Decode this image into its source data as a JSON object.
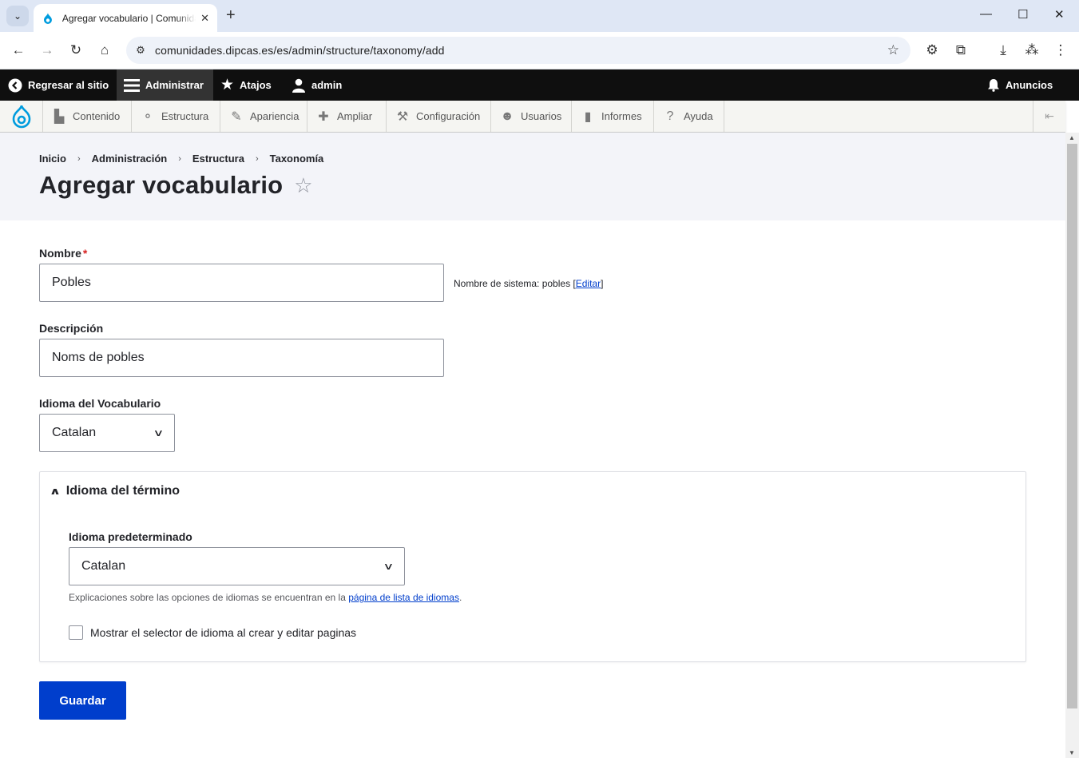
{
  "browser": {
    "tab_title": "Agregar vocabulario | Comunidades",
    "url": "comunidades.dipcas.es/es/admin/structure/taxonomy/add"
  },
  "admin_toolbar": {
    "back_to_site": "Regresar al sitio",
    "manage": "Administrar",
    "shortcuts": "Atajos",
    "user": "admin",
    "announcements": "Anuncios"
  },
  "admin_menu": {
    "items": [
      "Contenido",
      "Estructura",
      "Apariencia",
      "Ampliar",
      "Configuración",
      "Usuarios",
      "Informes",
      "Ayuda"
    ]
  },
  "breadcrumb": [
    "Inicio",
    "Administración",
    "Estructura",
    "Taxonomía"
  ],
  "page_title": "Agregar vocabulario",
  "form": {
    "name": {
      "label": "Nombre",
      "required_mark": "*",
      "value": "Pobles",
      "machine_name_prefix": "Nombre de sistema: pobles ",
      "machine_name_edit": "Editar"
    },
    "description": {
      "label": "Descripción",
      "value": "Noms de pobles"
    },
    "vocabulary_language": {
      "label": "Idioma del Vocabulario",
      "selected": "Catalan"
    },
    "term_language": {
      "summary": "Idioma del término",
      "default_language_label": "Idioma predeterminado",
      "default_language_selected": "Catalan",
      "help_prefix": "Explicaciones sobre las opciones de idiomas se encuentran en la ",
      "help_link": "página de lista de idiomas",
      "help_suffix": ".",
      "show_selector_label": "Mostrar el selector de idioma al crear y editar paginas",
      "show_selector_checked": false
    },
    "save_label": "Guardar"
  },
  "colors": {
    "primary": "#003ecc",
    "toolbar": "#0f0f0f",
    "required": "#d72222"
  }
}
